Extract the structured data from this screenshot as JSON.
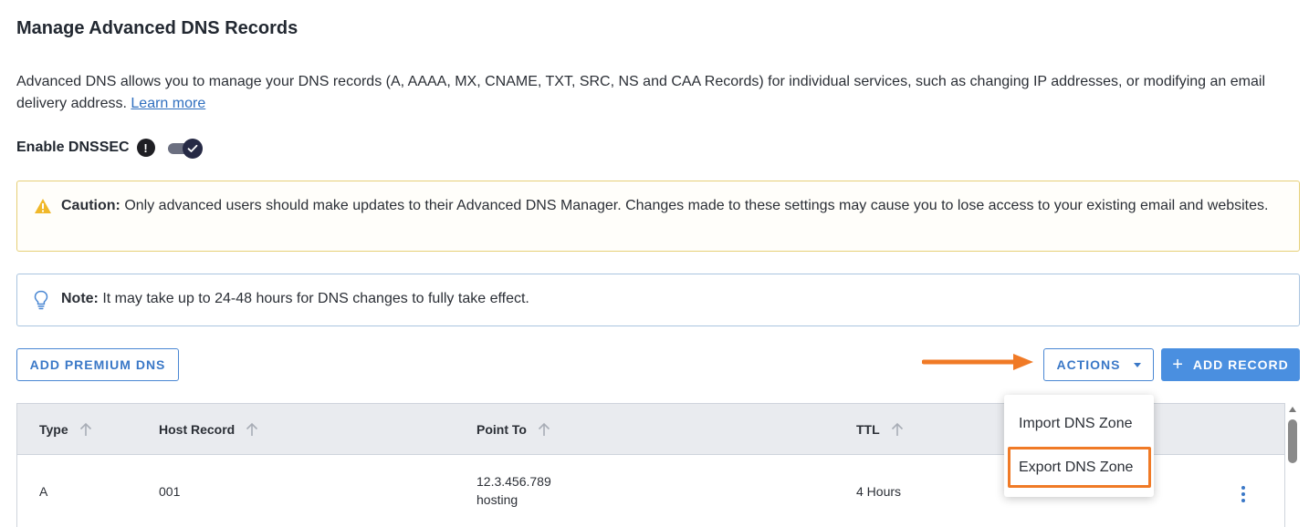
{
  "page": {
    "title": "Manage Advanced DNS Records",
    "description": "Advanced DNS allows you to manage your DNS records (A, AAAA, MX, CNAME, TXT, SRC, NS and CAA Records) for individual services, such as changing IP addresses, or modifying an email delivery address.",
    "learn_more": "Learn more"
  },
  "dnssec": {
    "label": "Enable DNSSEC",
    "info_glyph": "!",
    "enabled": true
  },
  "caution": {
    "label": "Caution:",
    "text": "Only advanced users should make updates to their Advanced DNS Manager. Changes made to these settings may cause you to lose access to your existing email and websites."
  },
  "note": {
    "label": "Note:",
    "text": "It may take up to 24-48 hours for DNS changes to fully take effect."
  },
  "toolbar": {
    "add_premium_label": "ADD PREMIUM DNS",
    "actions_label": "ACTIONS",
    "add_record_plus": "+",
    "add_record_label": "ADD RECORD"
  },
  "actions_menu": {
    "items": [
      "Import DNS Zone",
      "Export DNS Zone"
    ],
    "highlighted": "Export DNS Zone"
  },
  "table": {
    "columns": [
      "Type",
      "Host Record",
      "Point To",
      "TTL"
    ],
    "rows": [
      {
        "type": "A",
        "host": "001",
        "point_to": "12.3.456.789",
        "point_to_sub": "hosting",
        "ttl": "4 Hours"
      }
    ]
  },
  "icons": {
    "info": "exclamation-circle-icon",
    "toggle_check": "check-icon",
    "warning": "warning-triangle-icon",
    "note": "lightbulb-icon",
    "sort": "sort-up-arrow-icon",
    "caret": "caret-down-icon",
    "kebab": "vertical-ellipsis-icon",
    "annotation": "orange-arrow-icon"
  },
  "colors": {
    "accent": "#4a8fe0",
    "link": "#2f6fbf",
    "caution_border": "#e6cf77",
    "note_border": "#a9c4df",
    "highlight": "#f07a26",
    "toggle_knob": "#262a45"
  }
}
